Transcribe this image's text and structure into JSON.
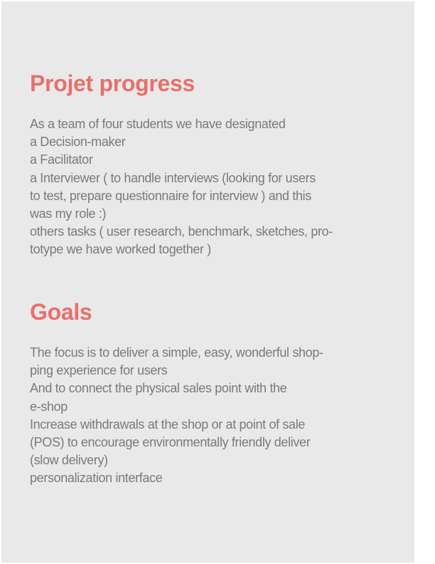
{
  "progress": {
    "title": "Projet progress",
    "lines": [
      "As a team of four students we have designated",
      "a Decision-maker",
      "a Facilitator",
      "a Interviewer  (  to handle  interviews (looking for users",
      "to test, prepare questionnaire for interview ) and this",
      "was my role :)",
      "others tasks ( user research, benchmark, sketches, pro-",
      "totype we have worked together )"
    ]
  },
  "goals": {
    "title": "Goals",
    "lines": [
      "The focus is to deliver a simple, easy, wonderful shop-",
      "ping experience for users",
      "And to connect the physical sales point with the",
      "e-shop",
      "Increase withdrawals at the shop or at point of sale",
      "(POS)  to encourage environmentally friendly deliver",
      " (slow delivery)",
      "personalization interface"
    ]
  }
}
